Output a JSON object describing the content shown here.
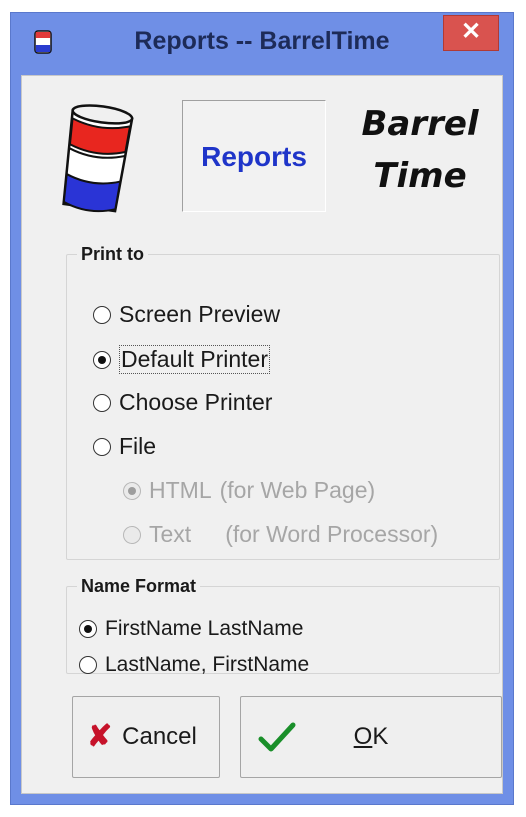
{
  "window": {
    "title": "Reports -- BarrelTime",
    "close_label": "✕"
  },
  "header": {
    "reports_label": "Reports",
    "brand_line1": "Barrel",
    "brand_line2": "Time"
  },
  "print_to": {
    "legend": "Print to",
    "options": [
      {
        "label": "Screen Preview",
        "checked": false,
        "enabled": true
      },
      {
        "label": "Default Printer",
        "checked": true,
        "enabled": true
      },
      {
        "label": "Choose Printer",
        "checked": false,
        "enabled": true
      },
      {
        "label": "File",
        "checked": false,
        "enabled": true
      }
    ],
    "file_formats": [
      {
        "label": "HTML",
        "note": "(for Web Page)",
        "checked": true,
        "enabled": false
      },
      {
        "label": "Text",
        "note": "(for Word Processor)",
        "checked": false,
        "enabled": false
      }
    ]
  },
  "name_format": {
    "legend": "Name Format",
    "options": [
      {
        "label": "FirstName LastName",
        "checked": true
      },
      {
        "label": "LastName, FirstName",
        "checked": false
      }
    ]
  },
  "buttons": {
    "cancel_label": "Cancel",
    "ok_label_prefix": "",
    "ok_mnemonic": "O",
    "ok_label_rest": "K"
  },
  "colors": {
    "accent_blue": "#1f35c9",
    "cancel_x": "#c6122a",
    "ok_check": "#1a8f2a",
    "window_frame": "#6f8fe6",
    "close_button": "#d9534f"
  },
  "icons": {
    "app": "barrel-icon",
    "logo": "barrel-logo",
    "close": "close-icon",
    "cancel": "x-icon",
    "ok": "checkmark-icon"
  }
}
